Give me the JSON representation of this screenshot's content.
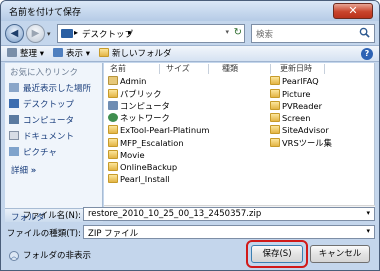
{
  "window": {
    "title": "名前を付けて保存",
    "close_glyph": "✕"
  },
  "nav": {
    "back_glyph": "◀",
    "forward_glyph": "▶",
    "dropdown_glyph": "▾",
    "address_sep": "▸",
    "address": "デスクトップ",
    "address_sep2": "▸",
    "address_dropdown_glyph": "▾",
    "refresh_glyph": "↻",
    "search_placeholder": "検索"
  },
  "toolbar": {
    "organize": "整理",
    "views": "表示",
    "new_folder": "新しいフォルダ",
    "help": "?"
  },
  "sidebar": {
    "favorites_title": "お気に入りリンク",
    "items": [
      {
        "label": "最近表示した場所",
        "icon": "recent-places-icon"
      },
      {
        "label": "デスクトップ",
        "icon": "desktop-icon"
      },
      {
        "label": "コンピュータ",
        "icon": "computer-icon"
      },
      {
        "label": "ドキュメント",
        "icon": "documents-icon"
      },
      {
        "label": "ピクチャ",
        "icon": "pictures-icon"
      }
    ],
    "details": "詳細",
    "details_glyph": "»",
    "folders_label": "フォルダ",
    "folders_glyph": "︿"
  },
  "columns": [
    "名前",
    "サイズ",
    "種類",
    "更新日時"
  ],
  "files_col1": [
    {
      "name": "Admin",
      "icon": "folder-user-icon"
    },
    {
      "name": "パブリック",
      "icon": "folder-public-icon"
    },
    {
      "name": "コンピュータ",
      "icon": "computer-icon"
    },
    {
      "name": "ネットワーク",
      "icon": "network-icon"
    },
    {
      "name": "ExTool-Pearl-Platinum",
      "icon": "folder-icon"
    },
    {
      "name": "MFP_Escalation",
      "icon": "folder-icon"
    },
    {
      "name": "Movie",
      "icon": "folder-icon"
    },
    {
      "name": "OnlineBackup",
      "icon": "folder-icon"
    },
    {
      "name": "Pearl_Install",
      "icon": "folder-icon"
    }
  ],
  "files_col2": [
    {
      "name": "PearlFAQ",
      "icon": "folder-icon"
    },
    {
      "name": "Picture",
      "icon": "folder-icon"
    },
    {
      "name": "PVReader",
      "icon": "folder-icon"
    },
    {
      "name": "Screen",
      "icon": "folder-icon"
    },
    {
      "name": "SiteAdvisor",
      "icon": "folder-icon"
    },
    {
      "name": "VRSツール集",
      "icon": "folder-icon"
    }
  ],
  "scrollbar": {
    "left_glyph": "◂",
    "right_glyph": "▸"
  },
  "form": {
    "filename_label": "ファイル名(N):",
    "filename_value": "restore_2010_10_25_00_13_2450357.zip",
    "filetype_label": "ファイルの種類(T):",
    "filetype_value": "ZIP ファイル",
    "dropdown_glyph": "▾"
  },
  "hide_folders": {
    "label": "フォルダの非表示",
    "glyph": "︿"
  },
  "buttons": {
    "save": "保存(S)",
    "cancel": "キャンセル"
  },
  "colors": {
    "accent": "#d11a1a",
    "folder": "#e3b445",
    "link": "#1b3f7d"
  }
}
